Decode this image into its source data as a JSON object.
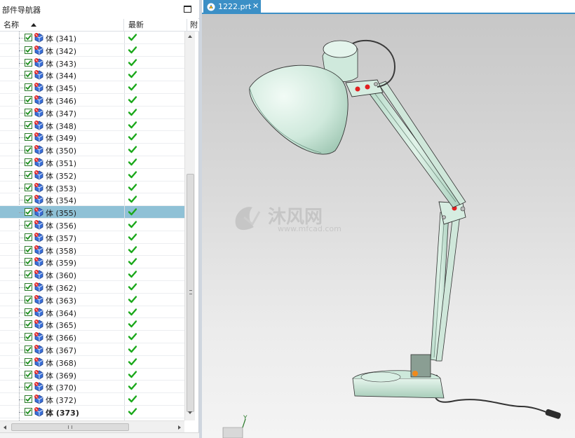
{
  "navigator": {
    "title": "部件导航器",
    "columns": {
      "name": "名称",
      "latest": "最新",
      "extra": "附"
    },
    "rows": [
      {
        "label": "体 (341)",
        "latest": true
      },
      {
        "label": "体 (342)",
        "latest": true
      },
      {
        "label": "体 (343)",
        "latest": true
      },
      {
        "label": "体 (344)",
        "latest": true
      },
      {
        "label": "体 (345)",
        "latest": true
      },
      {
        "label": "体 (346)",
        "latest": true
      },
      {
        "label": "体 (347)",
        "latest": true
      },
      {
        "label": "体 (348)",
        "latest": true
      },
      {
        "label": "体 (349)",
        "latest": true
      },
      {
        "label": "体 (350)",
        "latest": true
      },
      {
        "label": "体 (351)",
        "latest": true
      },
      {
        "label": "体 (352)",
        "latest": true
      },
      {
        "label": "体 (353)",
        "latest": true
      },
      {
        "label": "体 (354)",
        "latest": true
      },
      {
        "label": "体 (355)",
        "latest": true,
        "selected": true
      },
      {
        "label": "体 (356)",
        "latest": true
      },
      {
        "label": "体 (357)",
        "latest": true
      },
      {
        "label": "体 (358)",
        "latest": true
      },
      {
        "label": "体 (359)",
        "latest": true
      },
      {
        "label": "体 (360)",
        "latest": true
      },
      {
        "label": "体 (362)",
        "latest": true
      },
      {
        "label": "体 (363)",
        "latest": true
      },
      {
        "label": "体 (364)",
        "latest": true
      },
      {
        "label": "体 (365)",
        "latest": true
      },
      {
        "label": "体 (366)",
        "latest": true
      },
      {
        "label": "体 (367)",
        "latest": true
      },
      {
        "label": "体 (368)",
        "latest": true
      },
      {
        "label": "体 (369)",
        "latest": true
      },
      {
        "label": "体 (370)",
        "latest": true
      },
      {
        "label": "体 (372)",
        "latest": true
      },
      {
        "label": "体 (373)",
        "latest": true,
        "bold": true
      }
    ]
  },
  "document": {
    "tab_label": "1222.prt",
    "close_symbol": "✕"
  },
  "watermark": {
    "brand": "沐风网",
    "url": "www.mfcad.com"
  },
  "triad": {
    "y_label": "Y"
  },
  "icons": {
    "maximize": "maximize-icon",
    "sort": "sort-ascending-icon",
    "checkbox": "checkbox-checked-icon",
    "body": "solid-body-icon",
    "latest": "green-check-icon",
    "part_file": "part-file-icon"
  },
  "colors": {
    "selection": "#8fc1d6",
    "tab_active": "#3b8fc6",
    "lamp_body": "#d2ece1",
    "check_green": "#1aa81a"
  }
}
